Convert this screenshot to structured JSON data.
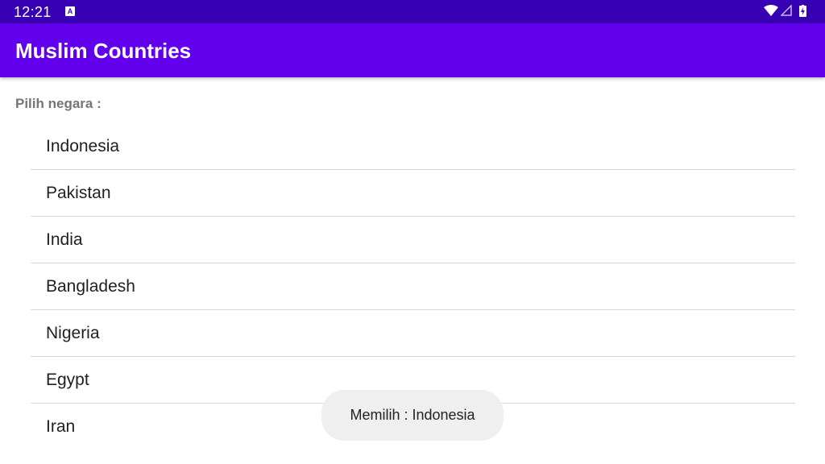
{
  "status_bar": {
    "time": "12:21",
    "notification_icon": "a-letter-notification-icon",
    "icons": [
      "wifi-icon",
      "cell-signal-icon",
      "battery-charging-icon"
    ],
    "color": "#3700b3"
  },
  "app_bar": {
    "title": "Muslim Countries",
    "color": "#6200ee"
  },
  "main": {
    "prompt": "Pilih negara :",
    "countries": [
      "Indonesia",
      "Pakistan",
      "India",
      "Bangladesh",
      "Nigeria",
      "Egypt",
      "Iran"
    ]
  },
  "toast": {
    "text": "Memilih : Indonesia"
  }
}
